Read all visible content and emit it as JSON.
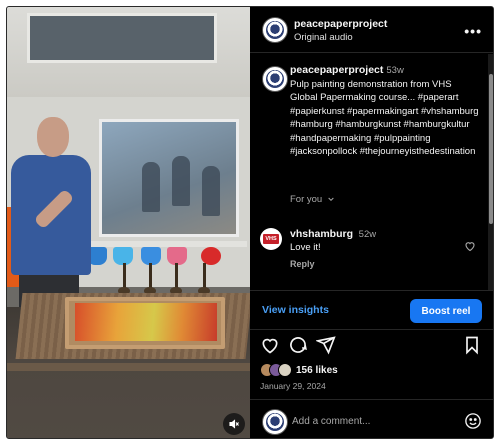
{
  "header": {
    "username": "peacepaperproject",
    "subtitle": "Original audio",
    "more_icon": "more-horizontal-icon"
  },
  "caption": {
    "username": "peacepaperproject",
    "time": "53w",
    "text": "Pulp painting demonstration from VHS Global Papermaking course... #paperart #papierkunst #papermakingart #vhshamburg #hamburg #hamburgkunst #hamburgkultur #handpapermaking #pulppainting #jacksonpollock #thejourneyisthedestination"
  },
  "for_you": "For you",
  "comment": {
    "username": "vhshamburg",
    "time": "52w",
    "text": "Love it!",
    "reply_label": "Reply",
    "avatar_text": "VHS"
  },
  "insights": {
    "view_label": "View insights",
    "boost_label": "Boost reel"
  },
  "likes": "156 likes",
  "date": "January 29, 2024",
  "add_comment_placeholder": "Add a comment...",
  "colors": {
    "accent_blue": "#1877f2",
    "link_blue": "#4a9ff5",
    "background": "#000000",
    "muted_text": "#a8a8a8"
  }
}
